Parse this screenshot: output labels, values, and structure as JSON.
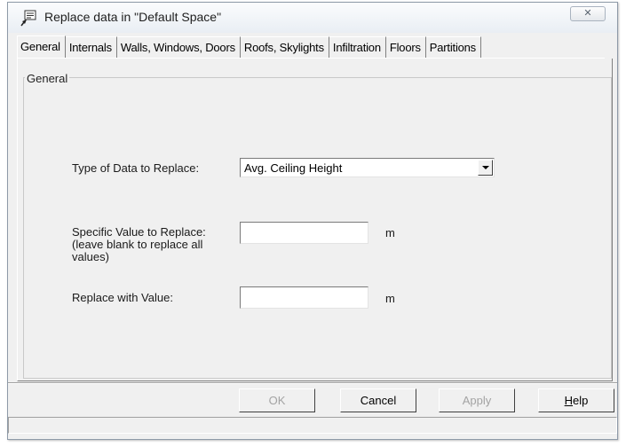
{
  "window": {
    "title": "Replace data in \"Default Space\"",
    "close_glyph": "✕",
    "icon": "replace-data-icon"
  },
  "tabs": [
    {
      "label": "General",
      "selected": true
    },
    {
      "label": "Internals"
    },
    {
      "label": "Walls, Windows, Doors"
    },
    {
      "label": "Roofs, Skylights"
    },
    {
      "label": "Infiltration"
    },
    {
      "label": "Floors"
    },
    {
      "label": "Partitions"
    }
  ],
  "general": {
    "group_title": "General",
    "type_label": "Type of Data to Replace:",
    "type_value": "Avg. Ceiling Height",
    "specific_label": "Specific Value to Replace: (leave blank to replace all values)",
    "specific_value": "",
    "specific_unit": "m",
    "replace_label": "Replace with Value:",
    "replace_value": "",
    "replace_unit": "m"
  },
  "buttons": {
    "ok": "OK",
    "cancel": "Cancel",
    "apply": "Apply",
    "help": "Help"
  },
  "colors": {
    "dialog_bg": "#f0f0f0",
    "disabled_text": "#a3a3a3"
  }
}
